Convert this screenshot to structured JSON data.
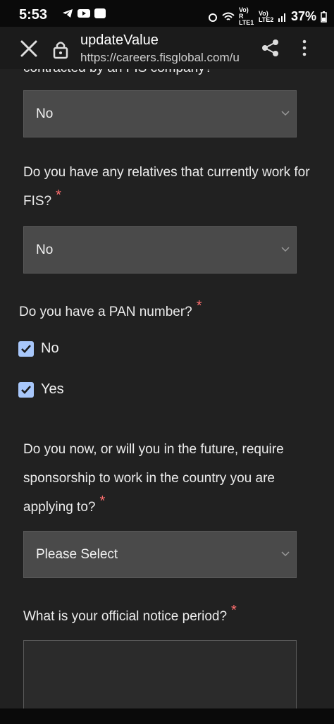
{
  "status_bar": {
    "time": "5:53",
    "battery": "37%",
    "sim1": "Vo) R LTE1",
    "sim2": "Vo) LTE2"
  },
  "browser": {
    "page_title": "updateValue",
    "url": "https://careers.fisglobal.com/u",
    "icons": [
      "close-icon",
      "lock-icon",
      "share-icon",
      "more-vert-icon"
    ]
  },
  "form": {
    "q_contracted_tail": "contracted by an FIS company?",
    "q_contracted_answer": "No",
    "q_relatives": "Do you have any relatives that currently work for FIS?",
    "q_relatives_answer": "No",
    "q_pan": "Do you have a PAN number?",
    "pan_options": [
      {
        "label": "No",
        "checked": true
      },
      {
        "label": "Yes",
        "checked": true
      }
    ],
    "q_sponsorship": "Do you now, or will you in the future, require sponsorship to work in the country you are applying to?",
    "q_sponsorship_answer": "Please Select",
    "q_notice": "What is your official notice period?",
    "required_mark": "*"
  },
  "colors": {
    "background": "#212121",
    "select_bg": "#4a4a4a",
    "required": "#ff6f6f",
    "checkbox": "#a8c7fa"
  }
}
